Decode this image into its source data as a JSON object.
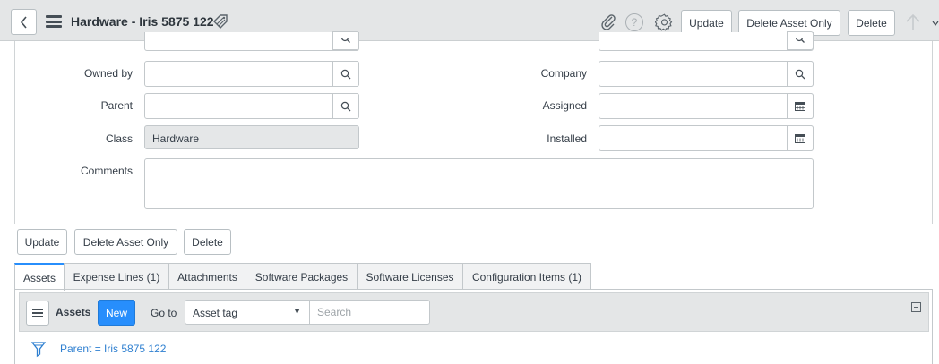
{
  "header": {
    "title": "Hardware - Iris 5875 122",
    "buttons": {
      "update": "Update",
      "delete_asset_only": "Delete Asset Only",
      "delete": "Delete"
    },
    "help_glyph": "?"
  },
  "form": {
    "left": [
      {
        "label": "Owned by",
        "value": ""
      },
      {
        "label": "Parent",
        "value": ""
      },
      {
        "label": "Class",
        "value": "Hardware"
      },
      {
        "label": "Comments",
        "value": ""
      }
    ],
    "right": [
      {
        "label": "Company",
        "value": ""
      },
      {
        "label": "Assigned",
        "value": ""
      },
      {
        "label": "Installed",
        "value": ""
      }
    ]
  },
  "actions": {
    "update": "Update",
    "delete_asset_only": "Delete Asset Only",
    "delete": "Delete"
  },
  "tabs": [
    {
      "label": "Assets",
      "active": true
    },
    {
      "label": "Expense Lines (1)"
    },
    {
      "label": "Attachments"
    },
    {
      "label": "Software Packages"
    },
    {
      "label": "Software Licenses"
    },
    {
      "label": "Configuration Items (1)"
    }
  ],
  "related_list": {
    "title": "Assets",
    "new_label": "New",
    "goto_label": "Go to",
    "goto_selected": "Asset tag",
    "search_placeholder": "Search",
    "filter_breadcrumb": "Parent = Iris 5875 122"
  },
  "colors": {
    "accent": "#278efc",
    "link": "#2e7fd0",
    "header_bg": "#e4e6e7"
  }
}
